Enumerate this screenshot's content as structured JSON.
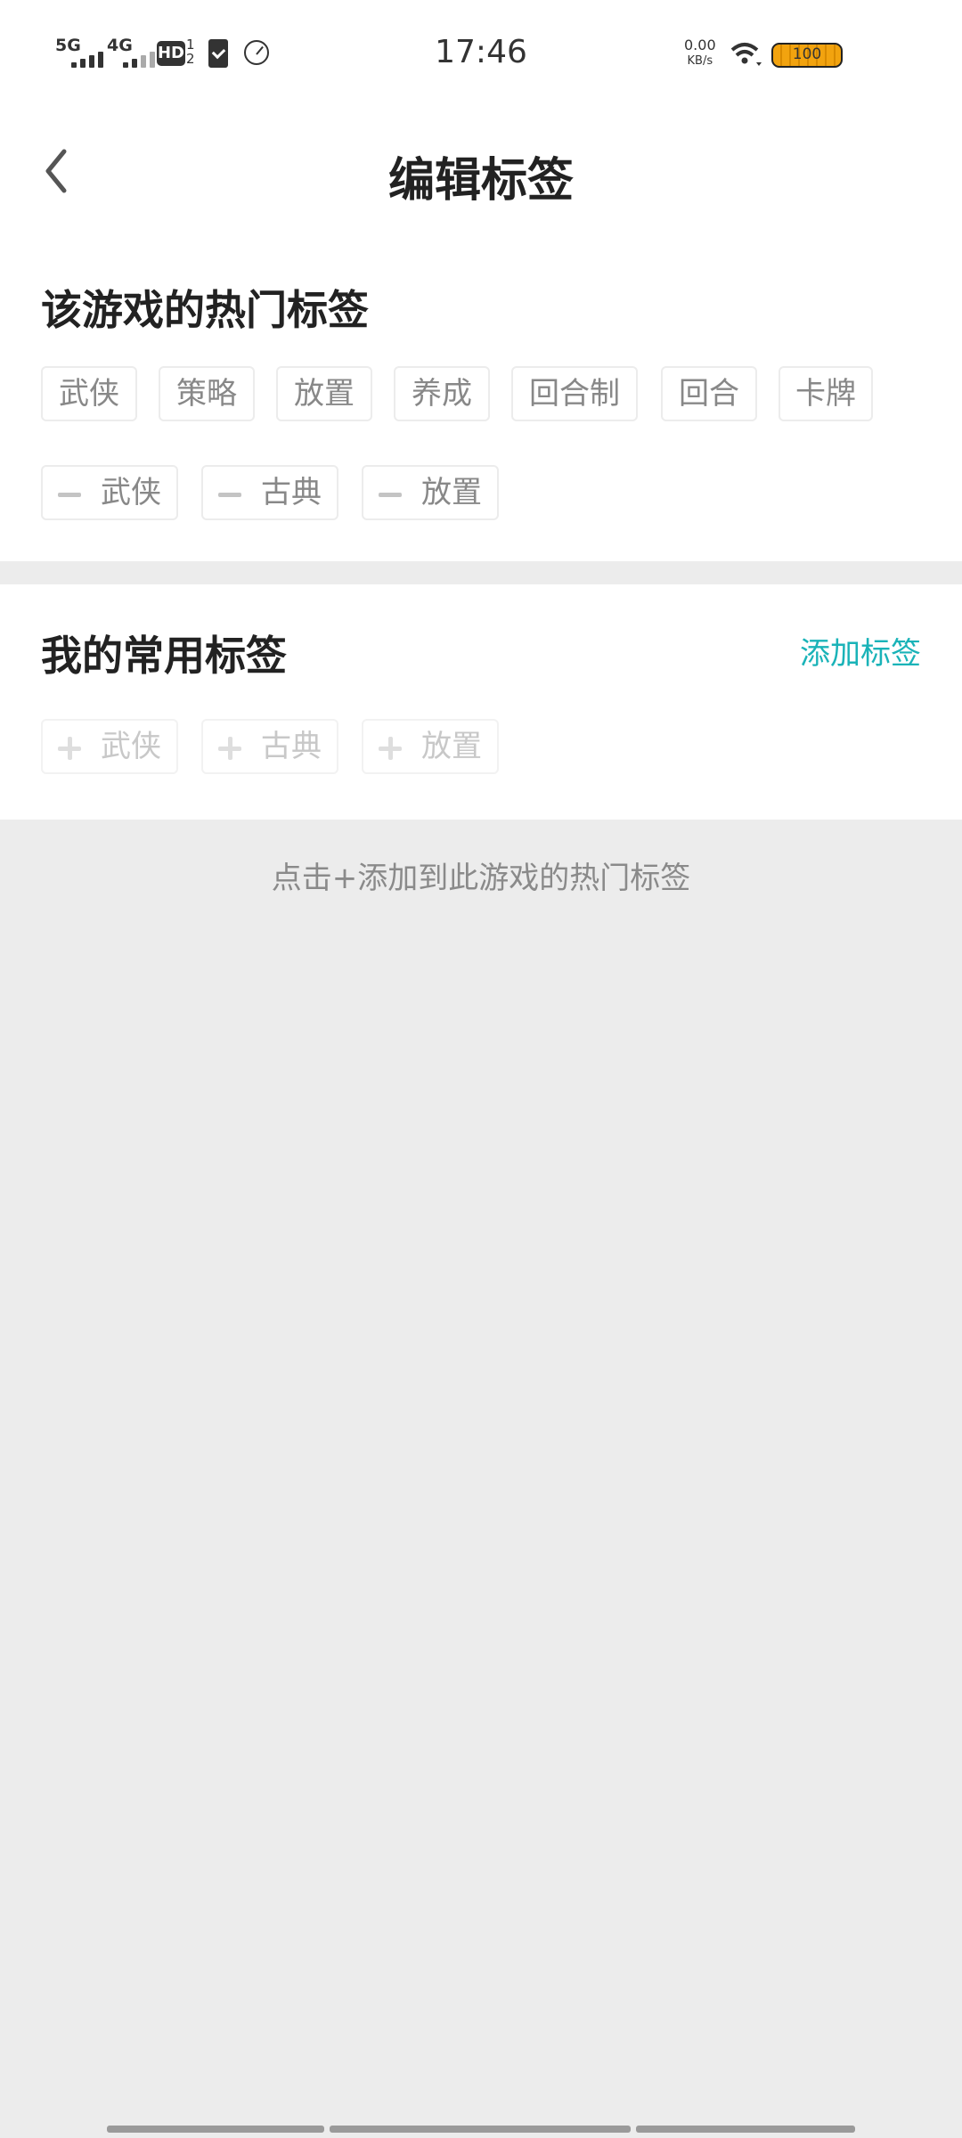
{
  "status_bar": {
    "signal1": "5G",
    "signal2": "4G",
    "hd": "HD",
    "hd_num": "1\n2",
    "time": "17:46",
    "net_speed": "0.00",
    "net_unit": "KB/s",
    "battery": "100"
  },
  "header": {
    "back_icon": "chevron-left-icon",
    "title": "编辑标签"
  },
  "hot_tags": {
    "title": "该游戏的热门标签",
    "tags": [
      "武侠",
      "策略",
      "放置",
      "养成",
      "回合制",
      "回合",
      "卡牌"
    ],
    "selected": [
      "武侠",
      "古典",
      "放置"
    ]
  },
  "my_tags": {
    "title": "我的常用标签",
    "add_label": "添加标签",
    "tags": [
      "武侠",
      "古典",
      "放置"
    ]
  },
  "hint": "点击+添加到此游戏的热门标签",
  "colors": {
    "accent": "#1ab3b8",
    "background": "#ececec",
    "chip_text": "#888888"
  }
}
